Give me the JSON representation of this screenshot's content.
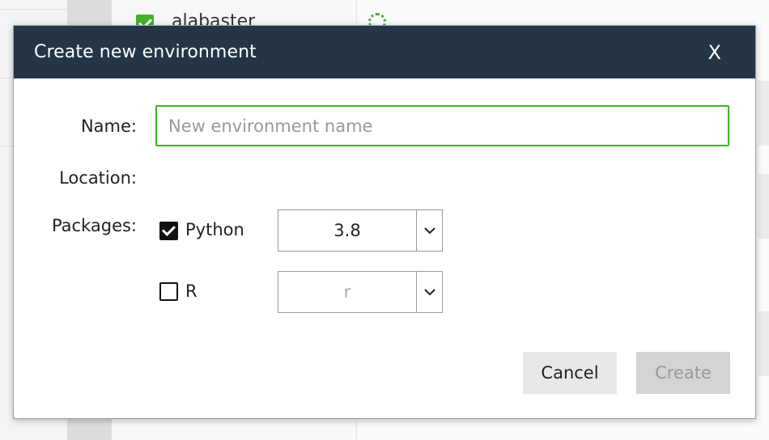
{
  "background": {
    "list_item_label": "alabaster"
  },
  "dialog": {
    "title": "Create new environment",
    "close_label": "X",
    "name_label": "Name:",
    "name_placeholder": "New environment name",
    "name_value": "",
    "location_label": "Location:",
    "packages_label": "Packages:",
    "packages": [
      {
        "label": "Python",
        "checked": true,
        "version": "3.8",
        "enabled": true
      },
      {
        "label": "R",
        "checked": false,
        "version": "r",
        "enabled": false
      }
    ],
    "cancel_label": "Cancel",
    "create_label": "Create"
  },
  "colors": {
    "header_bg": "#243546",
    "accent_green": "#43b02a"
  },
  "icons": {
    "close": "close-icon",
    "dropdown": "chevron-down-icon",
    "check": "checkmark-icon",
    "spinner": "loading-spinner-icon"
  }
}
